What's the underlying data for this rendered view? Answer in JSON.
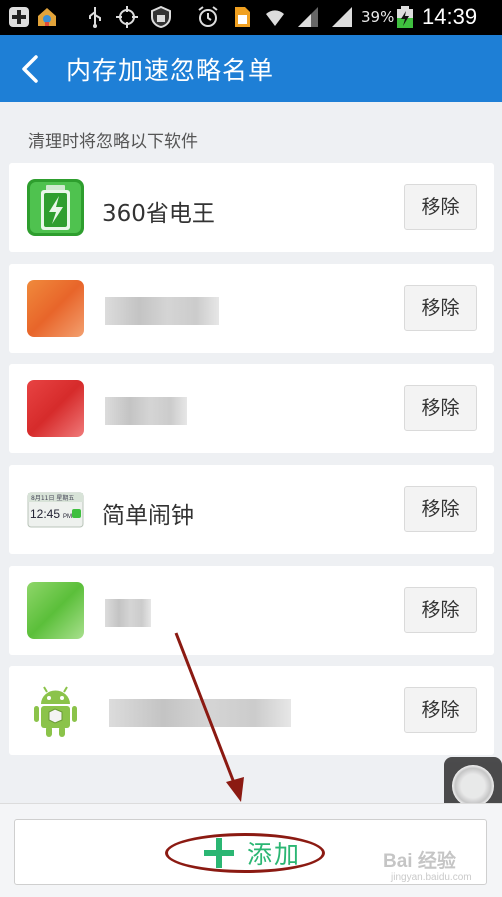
{
  "status_bar": {
    "battery_percent": "39%",
    "time": "14:39",
    "icons": [
      "plus-icon",
      "store-icon",
      "usb-icon",
      "gps-icon",
      "shield-icon",
      "alarm-icon",
      "sim-icon",
      "wifi-icon",
      "signal-icon",
      "signal-icon",
      "battery-charging-icon"
    ]
  },
  "header": {
    "back_icon": "chevron-left-icon",
    "title": "内存加速忽略名单"
  },
  "subtitle": "清理时将忽略以下软件",
  "apps": [
    {
      "name": "360省电王",
      "icon": "battery-app-icon",
      "remove_label": "移除"
    },
    {
      "name": "",
      "icon": "blurred-app-icon",
      "remove_label": "移除"
    },
    {
      "name": "",
      "icon": "blurred-app-icon",
      "remove_label": "移除"
    },
    {
      "name": "简单闹钟",
      "icon": "clock-app-icon",
      "remove_label": "移除"
    },
    {
      "name": "",
      "icon": "blurred-app-icon",
      "remove_label": "移除"
    },
    {
      "name": "",
      "icon": "android-app-icon",
      "remove_label": "移除"
    }
  ],
  "add_button": {
    "icon": "plus-icon",
    "label": "添加"
  },
  "clock_icon_text": {
    "date": "8月11日 星期五",
    "time": "12:45",
    "ampm": "PM"
  },
  "watermark": {
    "brand": "Bai 经验",
    "url": "jingyan.baidu.com"
  },
  "colors": {
    "header": "#1e7fd6",
    "add_accent": "#2bb673",
    "annotation": "#8b1a12"
  }
}
